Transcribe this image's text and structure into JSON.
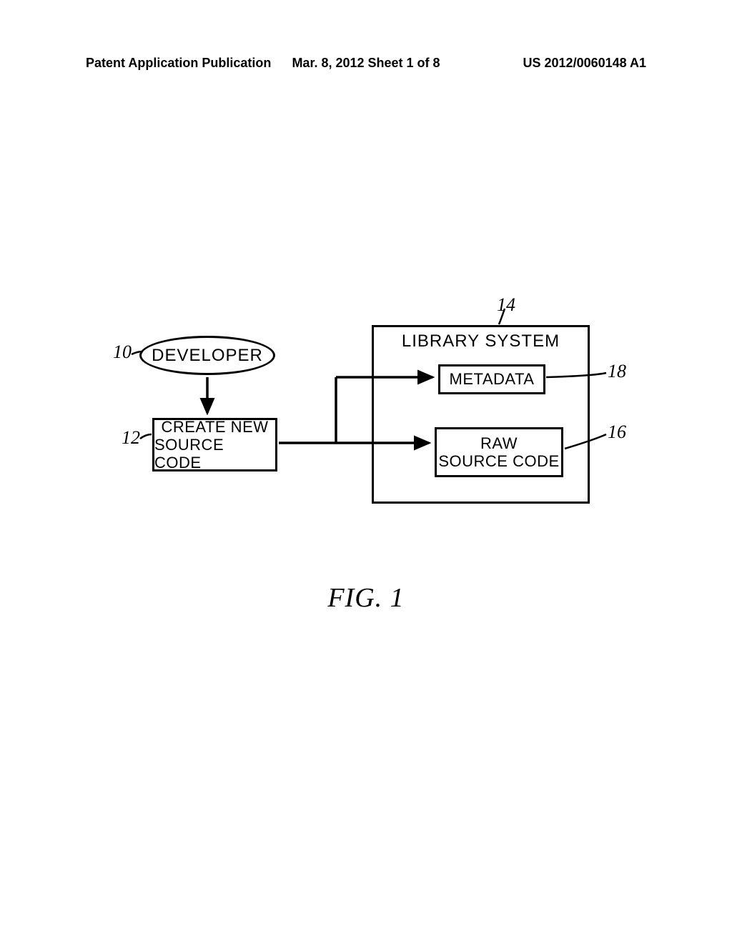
{
  "header": {
    "left": "Patent Application Publication",
    "center": "Mar. 8, 2012  Sheet 1 of 8",
    "right": "US 2012/0060148 A1"
  },
  "diagram": {
    "developer": "DEVELOPER",
    "create_line1": "CREATE NEW",
    "create_line2": "SOURCE CODE",
    "library_title": "LIBRARY SYSTEM",
    "metadata": "METADATA",
    "raw_line1": "RAW",
    "raw_line2": "SOURCE CODE",
    "refs": {
      "r10": "10",
      "r12": "12",
      "r14": "14",
      "r16": "16",
      "r18": "18"
    }
  },
  "figure_caption": "FIG. 1"
}
